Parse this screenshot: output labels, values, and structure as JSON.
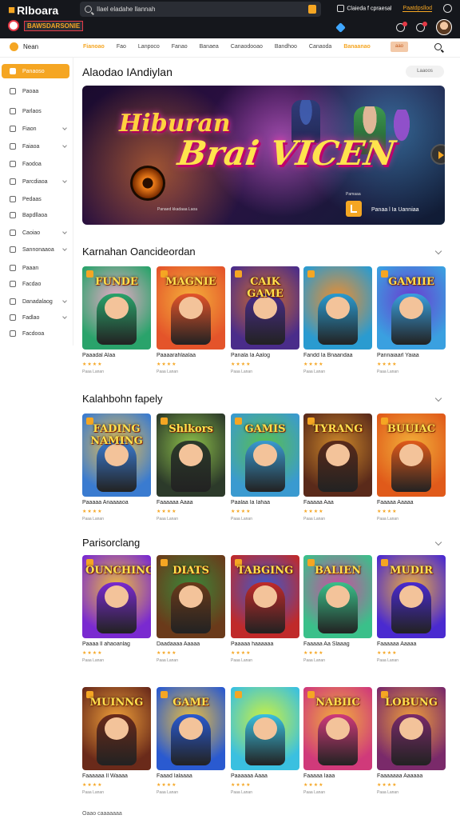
{
  "header": {
    "logo": "Rlboara",
    "search_placeholder": "Ilael eladahe llannah",
    "right_link1": "Claieda f cpraesal",
    "right_link2": "Paatdpsllod",
    "brand_text": "BAWSDARSONIE"
  },
  "nav": {
    "home": "Nean",
    "links": [
      "Fianoao",
      "Fao",
      "Lanpoco",
      "Fanao",
      "Banaea",
      "Canaodooao",
      "Bandhoo",
      "Canaoda",
      "Banaanao"
    ],
    "active_index": 8,
    "user_btn": "aao"
  },
  "sidebar": {
    "items": [
      {
        "label": "Panaoso",
        "active": true,
        "chevron": false
      },
      {
        "label": "Paoaa",
        "active": false,
        "chevron": false
      },
      {
        "label": "Parlaos",
        "active": false,
        "chevron": false
      },
      {
        "label": "Fiaon",
        "active": false,
        "chevron": true
      },
      {
        "label": "Faiaoa",
        "active": false,
        "chevron": true
      },
      {
        "label": "Faodoa",
        "active": false,
        "chevron": false
      },
      {
        "label": "Parcdiaoa",
        "active": false,
        "chevron": true
      },
      {
        "label": "Pedaas",
        "active": false,
        "chevron": false
      },
      {
        "label": "Bapdllaoa",
        "active": false,
        "chevron": false
      },
      {
        "label": "Caoiao",
        "active": false,
        "chevron": true
      },
      {
        "label": "Sannonaaoa",
        "active": false,
        "chevron": true
      },
      {
        "label": "Paaan",
        "active": false,
        "chevron": false
      },
      {
        "label": "Facdao",
        "active": false,
        "chevron": false
      },
      {
        "label": "Danadalaog",
        "active": false,
        "chevron": true
      },
      {
        "label": "Fadlao",
        "active": false,
        "chevron": true
      },
      {
        "label": "Facdooa",
        "active": false,
        "chevron": false
      }
    ]
  },
  "main": {
    "page_title": "Alaodao IAndiylan",
    "filter_btn": "Laaoos",
    "hero": {
      "line1": "Hiburan",
      "line2": "Brai VICEN",
      "small1": "Pamaaa",
      "small2": "Panaed kkadaaa\nLaoa",
      "caption": "Panaa l Ia Uanniaa"
    }
  },
  "sections": [
    {
      "title": "Karnahan Oancideordan",
      "cards": [
        {
          "title": "FUNDE",
          "name": "Paaadal Alaa",
          "meta": "Paaa Lanan",
          "c1": "#2aa36b",
          "c2": "#f0a9c9"
        },
        {
          "title": "MAGNIE",
          "name": "Paaaarahlaalaa",
          "meta": "Paaa Lanan",
          "c1": "#e4542a",
          "c2": "#f5b23a"
        },
        {
          "title": "CAIK GAME",
          "name": "Panala Ia Aalog",
          "meta": "Paaa Lanan",
          "c1": "#4a2c8a",
          "c2": "#d36d2a"
        },
        {
          "title": "",
          "name": "Fandd Ia Bnaandaa",
          "meta": "Paaa Lanan",
          "c1": "#2a9bd0",
          "c2": "#f28d2a"
        },
        {
          "title": "GAMIIE",
          "name": "Pannaiaarl Yaiaa",
          "meta": "Paaa Lanan",
          "c1": "#3aa0e0",
          "c2": "#6b3ad0"
        }
      ]
    },
    {
      "title": "Kalahbohn fapely",
      "cards": [
        {
          "title": "FADING NAMING",
          "name": "Paaaaa Anaaaaoa",
          "meta": "Paaa Lanan",
          "c1": "#3a7bd0",
          "c2": "#f2c24a"
        },
        {
          "title": "Shlkors",
          "name": "Faaaaaa Aaaa",
          "meta": "Paaa Lanan",
          "c1": "#2c3a2a",
          "c2": "#8fc24a"
        },
        {
          "title": "GAMIS",
          "name": "Paalaa Ia Iahaa",
          "meta": "Paaa Lanan",
          "c1": "#3a9ad0",
          "c2": "#5ac04a"
        },
        {
          "title": "TYRANG",
          "name": "Faaaaa Aaa",
          "meta": "Paaa Lanan",
          "c1": "#5a2a1a",
          "c2": "#d08a2a"
        },
        {
          "title": "BUUIAC",
          "name": "Faaaaa Aaaaa",
          "meta": "Paaa Lanan",
          "c1": "#e05a1a",
          "c2": "#f2b23a"
        }
      ]
    },
    {
      "title": "Parisorclang",
      "cards": [
        {
          "title": "OUNCHING",
          "name": "Paaaa ll ahaoanlag",
          "meta": "Paaa Lanan",
          "c1": "#7a2ad0",
          "c2": "#f2c23a"
        },
        {
          "title": "DIATS",
          "name": "Daadaaaa Aaaaa",
          "meta": "Paaa Lanan",
          "c1": "#6a3a1a",
          "c2": "#3a8a3a"
        },
        {
          "title": "TABGING",
          "name": "Paaaaa haaaaaa",
          "meta": "Paaa Lanan",
          "c1": "#c02a2a",
          "c2": "#3a5ad0"
        },
        {
          "title": "BALIEN",
          "name": "Faaaaa Aa Slaaag",
          "meta": "Paaa Lanan",
          "c1": "#3ac08a",
          "c2": "#d04aa0"
        },
        {
          "title": "MUDIR",
          "name": "Faaaaaa Aaaaa",
          "meta": "Paaa Lanan",
          "c1": "#4a2ad0",
          "c2": "#f2b23a"
        }
      ]
    },
    {
      "title": "",
      "cards": [
        {
          "title": "MUINNG",
          "name": "Faaaaaa Il Waaaa",
          "meta": "Paaa Lanan",
          "c1": "#6a2a1a",
          "c2": "#f2a23a"
        },
        {
          "title": "GAME",
          "name": "Faaad Ialaaaa",
          "meta": "Paaa Lanan",
          "c1": "#2a5ad0",
          "c2": "#f2c23a"
        },
        {
          "title": "",
          "name": "Paaaaaa Aaaa",
          "meta": "Paaa Lanan",
          "c1": "#3ac0e0",
          "c2": "#d0f23a"
        },
        {
          "title": "NABIIC",
          "name": "Faaaaa Iaaa",
          "meta": "Paaa Lanan",
          "c1": "#d03a7a",
          "c2": "#f2b23a"
        },
        {
          "title": "LOBUNG",
          "name": "Faaaaaaa Aaaaaa",
          "meta": "Paaa Lanan",
          "c1": "#7a2a6a",
          "c2": "#f2a23a"
        }
      ]
    }
  ],
  "footer": "Oaao caaaaaaa",
  "colors": {
    "accent": "#f5a623",
    "dark": "#15171c"
  },
  "icons": {
    "search": "search-icon",
    "lock": "lock-icon",
    "gear": "gear-icon",
    "bell": "bell-icon",
    "next": "chevron-right-icon"
  }
}
